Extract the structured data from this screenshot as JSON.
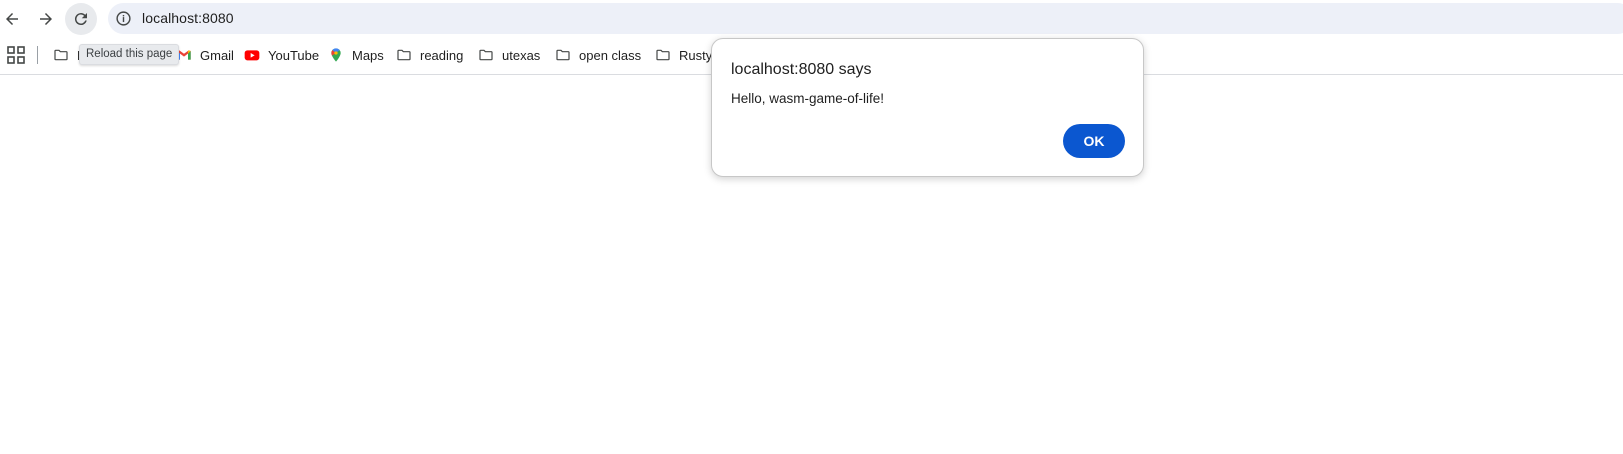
{
  "browser": {
    "url": "localhost:8080",
    "tooltip": "Reload this page"
  },
  "bookmarks": [
    {
      "label": "B",
      "icon": "folder-icon"
    },
    {
      "label": "Gmail",
      "icon": "gmail-icon"
    },
    {
      "label": "YouTube",
      "icon": "youtube-icon"
    },
    {
      "label": "Maps",
      "icon": "maps-icon"
    },
    {
      "label": "reading",
      "icon": "folder-icon"
    },
    {
      "label": "utexas",
      "icon": "folder-icon"
    },
    {
      "label": "open class",
      "icon": "folder-icon"
    },
    {
      "label": "Rusty",
      "icon": "folder-icon"
    }
  ],
  "dialog": {
    "title": "localhost:8080 says",
    "message": "Hello, wasm-game-of-life!",
    "ok_label": "OK"
  },
  "colors": {
    "accent": "#0b57d0",
    "omnibox_bg": "#edf0f8",
    "youtube_red": "#ff0000"
  }
}
